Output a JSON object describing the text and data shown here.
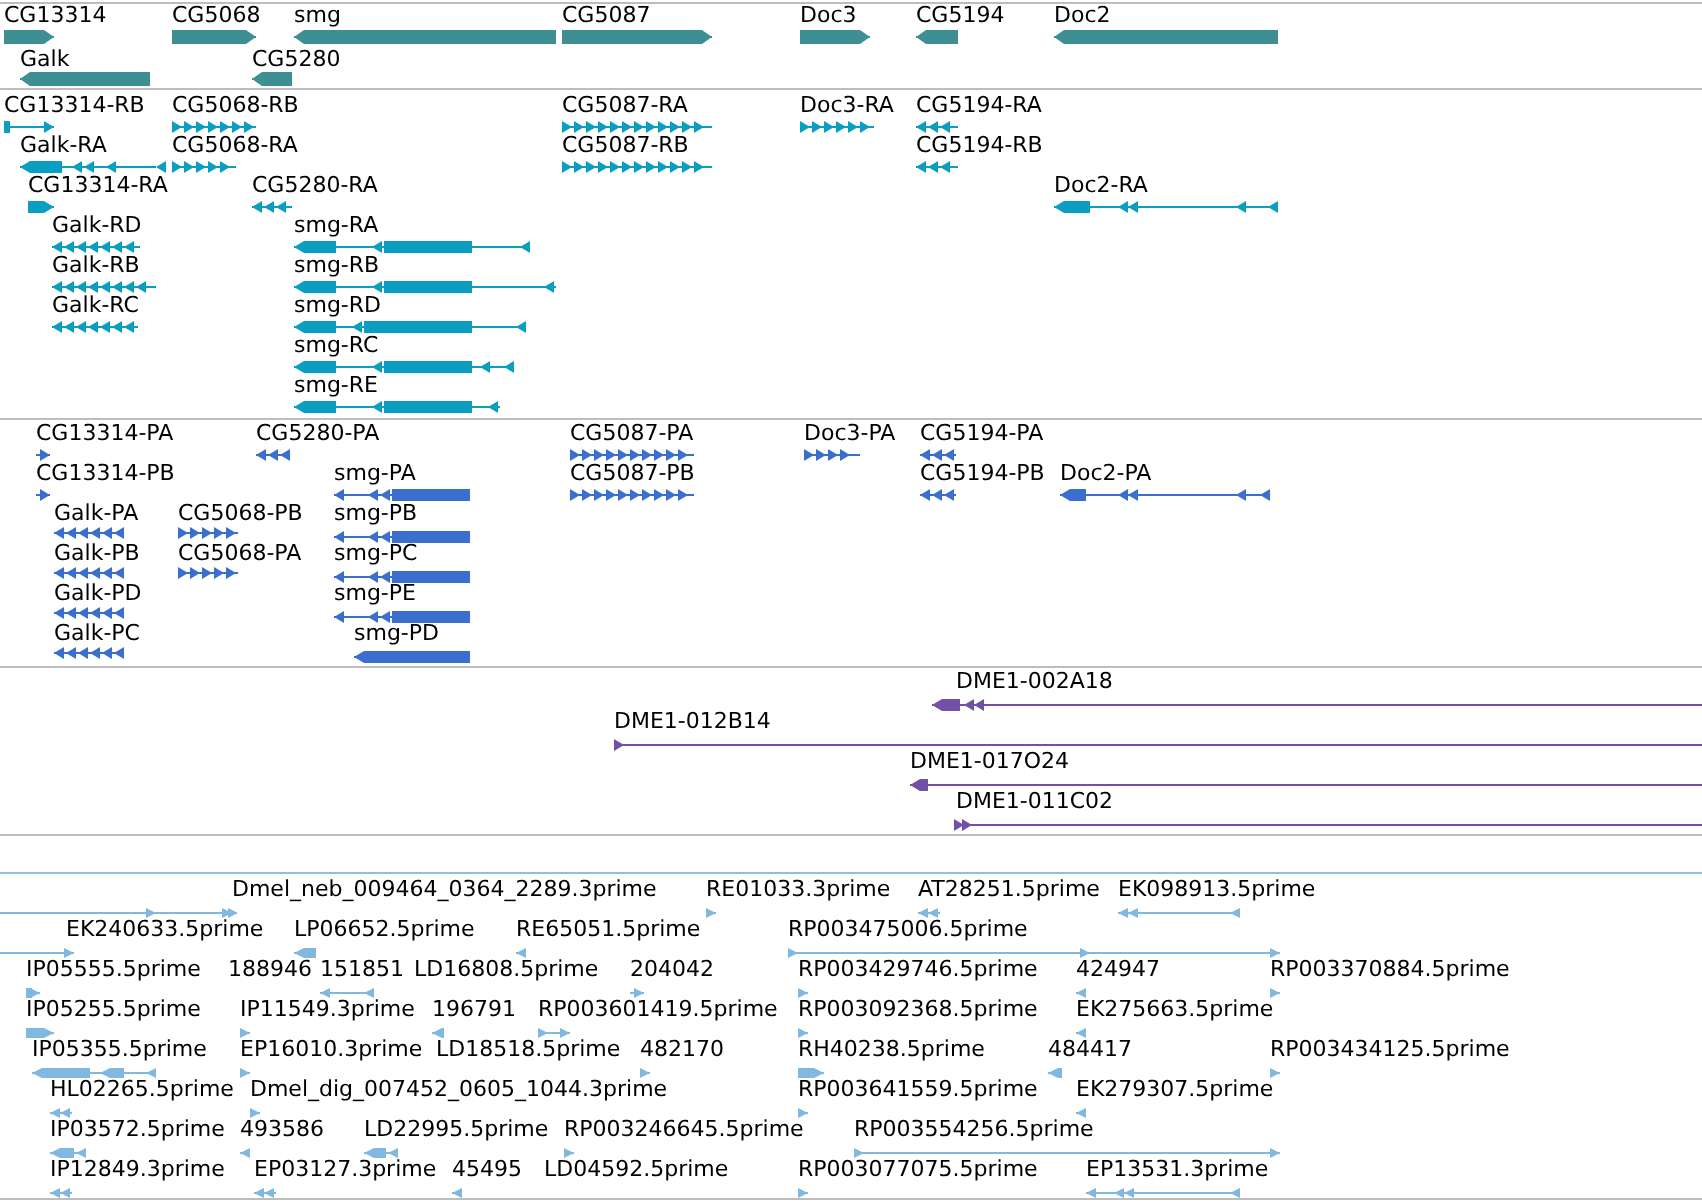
{
  "tracks": [
    {
      "kind": "gene",
      "color": "#3e8f93",
      "features": [
        {
          "label": "CG13314",
          "reverse": false
        },
        {
          "label": "CG5068",
          "reverse": false
        },
        {
          "label": "smg",
          "reverse": true
        },
        {
          "label": "CG5087",
          "reverse": false
        },
        {
          "label": "Doc3",
          "reverse": false
        },
        {
          "label": "CG5194",
          "reverse": true
        },
        {
          "label": "Doc2",
          "reverse": true
        },
        {
          "label": "Galk",
          "reverse": true
        },
        {
          "label": "CG5280",
          "reverse": true
        }
      ]
    },
    {
      "kind": "transcript",
      "color": "#0a9fc2",
      "features": [
        {
          "label": "CG13314-RB",
          "reverse": false
        },
        {
          "label": "CG5068-RB",
          "reverse": false
        },
        {
          "label": "CG5087-RA",
          "reverse": false
        },
        {
          "label": "Doc3-RA",
          "reverse": false
        },
        {
          "label": "CG5194-RA",
          "reverse": true
        },
        {
          "label": "Galk-RA",
          "reverse": true
        },
        {
          "label": "CG5068-RA",
          "reverse": false
        },
        {
          "label": "CG5087-RB",
          "reverse": false
        },
        {
          "label": "CG5194-RB",
          "reverse": true
        },
        {
          "label": "CG13314-RA",
          "reverse": false
        },
        {
          "label": "CG5280-RA",
          "reverse": true
        },
        {
          "label": "Doc2-RA",
          "reverse": true
        },
        {
          "label": "Galk-RD",
          "reverse": true
        },
        {
          "label": "smg-RA",
          "reverse": true
        },
        {
          "label": "Galk-RB",
          "reverse": true
        },
        {
          "label": "smg-RB",
          "reverse": true
        },
        {
          "label": "Galk-RC",
          "reverse": true
        },
        {
          "label": "smg-RD",
          "reverse": true
        },
        {
          "label": "smg-RC",
          "reverse": true
        },
        {
          "label": "smg-RE",
          "reverse": true
        }
      ]
    },
    {
      "kind": "protein",
      "color": "#3a6fd0",
      "features": [
        {
          "label": "CG13314-PA",
          "reverse": false
        },
        {
          "label": "CG5280-PA",
          "reverse": true
        },
        {
          "label": "CG5087-PA",
          "reverse": false
        },
        {
          "label": "Doc3-PA",
          "reverse": false
        },
        {
          "label": "CG5194-PA",
          "reverse": true
        },
        {
          "label": "CG13314-PB",
          "reverse": false
        },
        {
          "label": "smg-PA",
          "reverse": true
        },
        {
          "label": "CG5087-PB",
          "reverse": false
        },
        {
          "label": "CG5194-PB",
          "reverse": true
        },
        {
          "label": "Doc2-PA",
          "reverse": true
        },
        {
          "label": "Galk-PA",
          "reverse": true
        },
        {
          "label": "CG5068-PB",
          "reverse": false
        },
        {
          "label": "smg-PB",
          "reverse": true
        },
        {
          "label": "Galk-PB",
          "reverse": true
        },
        {
          "label": "CG5068-PA",
          "reverse": false
        },
        {
          "label": "smg-PC",
          "reverse": true
        },
        {
          "label": "Galk-PD",
          "reverse": true
        },
        {
          "label": "smg-PE",
          "reverse": true
        },
        {
          "label": "Galk-PC",
          "reverse": true
        },
        {
          "label": "smg-PD",
          "reverse": true
        }
      ]
    },
    {
      "kind": "clone",
      "color": "#7350a8",
      "features": [
        {
          "label": "DME1-002A18",
          "reverse": true
        },
        {
          "label": "DME1-012B14",
          "reverse": false
        },
        {
          "label": "DME1-017O24",
          "reverse": true
        },
        {
          "label": "DME1-011C02",
          "reverse": false
        }
      ]
    },
    {
      "kind": "est",
      "color": "#80b8e0",
      "features": [
        {
          "label": "Dmel_neb_009464_0364_2289.3prime",
          "reverse": false
        },
        {
          "label": "RE01033.3prime",
          "reverse": false
        },
        {
          "label": "AT28251.5prime",
          "reverse": true
        },
        {
          "label": "EK098913.5prime",
          "reverse": true
        },
        {
          "label": "EK240633.5prime",
          "reverse": false
        },
        {
          "label": "LP06652.5prime",
          "reverse": true
        },
        {
          "label": "RE65051.5prime",
          "reverse": true
        },
        {
          "label": "RP003475006.5prime",
          "reverse": false
        },
        {
          "label": "IP05555.5prime",
          "reverse": false
        },
        {
          "label": "188946"
        },
        {
          "label": "151851",
          "reverse": true
        },
        {
          "label": "LD16808.5prime"
        },
        {
          "label": "204042",
          "reverse": false
        },
        {
          "label": "RP003429746.5prime",
          "reverse": false
        },
        {
          "label": "424947",
          "reverse": true
        },
        {
          "label": "RP003370884.5prime",
          "reverse": false
        },
        {
          "label": "IP05255.5prime",
          "reverse": false
        },
        {
          "label": "IP11549.3prime",
          "reverse": false
        },
        {
          "label": "196791",
          "reverse": true
        },
        {
          "label": "RP003601419.5prime",
          "reverse": false
        },
        {
          "label": "RP003092368.5prime",
          "reverse": false
        },
        {
          "label": "EK275663.5prime",
          "reverse": true
        },
        {
          "label": "IP05355.5prime",
          "reverse": true
        },
        {
          "label": "EP16010.3prime",
          "reverse": false
        },
        {
          "label": "LD18518.5prime"
        },
        {
          "label": "482170",
          "reverse": false
        },
        {
          "label": "RH40238.5prime",
          "reverse": false
        },
        {
          "label": "484417",
          "reverse": true
        },
        {
          "label": "RP003434125.5prime",
          "reverse": false
        },
        {
          "label": "HL02265.5prime",
          "reverse": true
        },
        {
          "label": "Dmel_dig_007452_0605_1044.3prime",
          "reverse": false
        },
        {
          "label": "RP003641559.5prime",
          "reverse": false
        },
        {
          "label": "EK279307.5prime",
          "reverse": true
        },
        {
          "label": "IP03572.5prime",
          "reverse": true
        },
        {
          "label": "493586",
          "reverse": true
        },
        {
          "label": "LD22995.5prime",
          "reverse": true
        },
        {
          "label": "RP003246645.5prime",
          "reverse": false
        },
        {
          "label": "RP003554256.5prime",
          "reverse": false
        },
        {
          "label": "IP12849.3prime",
          "reverse": true
        },
        {
          "label": "EP03127.3prime",
          "reverse": true
        },
        {
          "label": "45495",
          "reverse": true
        },
        {
          "label": "LD04592.5prime"
        },
        {
          "label": "RP003077075.5prime",
          "reverse": false
        },
        {
          "label": "EP13531.3prime",
          "reverse": true
        }
      ]
    }
  ]
}
